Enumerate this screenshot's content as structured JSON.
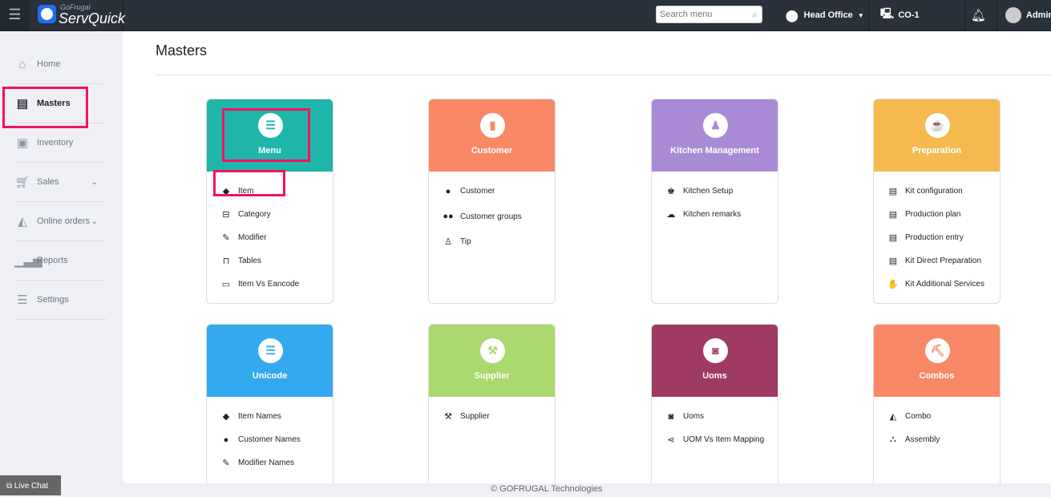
{
  "topbar": {
    "brand_small": "GoFrugal",
    "brand": "ServQuick",
    "search_placeholder": "Search menu",
    "location": "Head Office",
    "counter": "CO-1",
    "user": "Admin"
  },
  "sidebar": {
    "items": [
      {
        "label": "Home",
        "icon": "home-icon"
      },
      {
        "label": "Masters",
        "icon": "masters-icon"
      },
      {
        "label": "Inventory",
        "icon": "inventory-icon"
      },
      {
        "label": "Sales",
        "icon": "cart-icon"
      },
      {
        "label": "Online orders",
        "icon": "online-orders-icon"
      },
      {
        "label": "Reports",
        "icon": "reports-icon"
      },
      {
        "label": "Settings",
        "icon": "settings-icon"
      }
    ]
  },
  "page": {
    "title": "Masters"
  },
  "cards": [
    {
      "title": "Menu",
      "color": "#1fb5a9",
      "items": [
        "Item",
        "Category",
        "Modifier",
        "Tables",
        "Item Vs Eancode"
      ]
    },
    {
      "title": "Customer",
      "color": "#f98866",
      "items": [
        "Customer",
        "Customer groups",
        "Tip"
      ]
    },
    {
      "title": "Kitchen Management",
      "color": "#a98bd5",
      "items": [
        "Kitchen Setup",
        "Kitchen remarks"
      ]
    },
    {
      "title": "Preparation",
      "color": "#f4b94f",
      "items": [
        "Kit configuration",
        "Production plan",
        "Production entry",
        "Kit Direct Preparation",
        "Kit Additional Services"
      ]
    },
    {
      "title": "Unicode",
      "color": "#33aaef",
      "items": [
        "Item Names",
        "Customer Names",
        "Modifier Names"
      ]
    },
    {
      "title": "Supplier",
      "color": "#a9d86e",
      "items": [
        "Supplier"
      ]
    },
    {
      "title": "Uoms",
      "color": "#9e3a64",
      "items": [
        "Uoms",
        "UOM Vs Item Mapping"
      ]
    },
    {
      "title": "Combos",
      "color": "#f98866",
      "items": [
        "Combo",
        "Assembly"
      ]
    }
  ],
  "livechat": "Live Chat",
  "footer": "© GOFRUGAL Technologies"
}
